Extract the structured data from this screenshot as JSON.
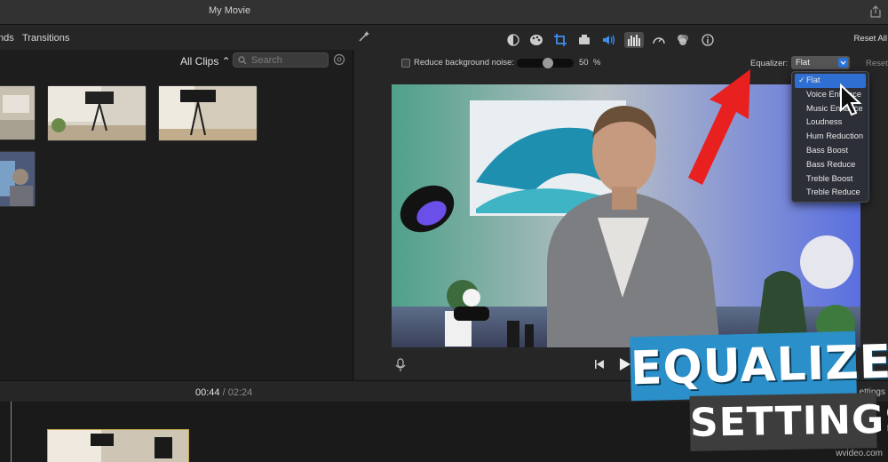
{
  "window": {
    "title": "My Movie"
  },
  "toolbar": {
    "tab_backgrounds": "nds",
    "tab_transitions": "Transitions"
  },
  "browser": {
    "filter_label": "All Clips ⌃",
    "search_placeholder": "Search"
  },
  "inspector": {
    "reset_all_label": "Reset All",
    "noise_label": "Reduce background noise:",
    "noise_value": "50",
    "noise_unit": "%",
    "noise_level_percent": 50,
    "equalizer_label": "Equalizer:",
    "equalizer_value": "Flat",
    "reset_label": "Reset"
  },
  "equalizer_menu": {
    "items": [
      "Flat",
      "Voice Enhance",
      "Music Enhance",
      "Loudness",
      "Hum Reduction",
      "Bass Boost",
      "Bass Reduce",
      "Treble Boost",
      "Treble Reduce"
    ],
    "selected": "Flat"
  },
  "timeline": {
    "current_time": "00:44",
    "separator": "/",
    "total_time": "02:24",
    "right_label": "ettings"
  },
  "overlay": {
    "line1": "EQUALIZER",
    "line2": "SETTINGS"
  },
  "watermark": "wvideo.com",
  "colors": {
    "accent": "#2f6fd1",
    "overlay_blue": "#2b8fc9",
    "arrow_red": "#e8201f"
  },
  "icons": [
    "share-icon",
    "magic-wand-icon",
    "color-balance-icon",
    "palette-icon",
    "crop-icon",
    "camera-icon",
    "volume-icon",
    "equalizer-icon",
    "speed-icon",
    "filter-icon",
    "info-icon",
    "search-icon",
    "gear-icon",
    "microphone-icon",
    "skip-back-icon",
    "play-icon"
  ]
}
